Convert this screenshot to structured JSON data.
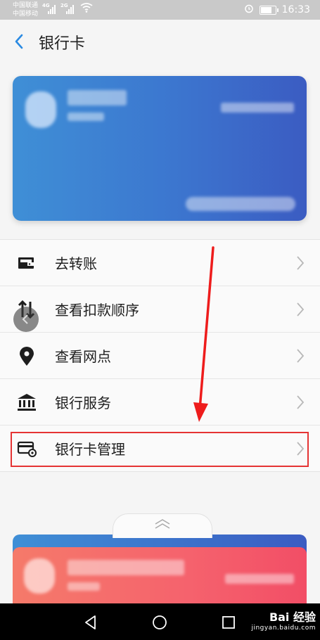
{
  "status_bar": {
    "carrier_1": "中国联通",
    "carrier_2": "中国移动",
    "network_1": "4G",
    "network_2": "2G",
    "time": "16:33",
    "icons": [
      "signal-icon",
      "wifi-icon",
      "alarm-icon",
      "battery-icon"
    ]
  },
  "header": {
    "title": "银行卡",
    "back_icon": "chevron-left-icon"
  },
  "menu": {
    "items": [
      {
        "label": "去转账",
        "icon": "wallet-icon"
      },
      {
        "label": "查看扣款顺序",
        "icon": "sort-arrows-icon"
      },
      {
        "label": "查看网点",
        "icon": "location-pin-icon"
      },
      {
        "label": "银行服务",
        "icon": "bank-icon"
      },
      {
        "label": "银行卡管理",
        "icon": "card-settings-icon"
      }
    ]
  },
  "colors": {
    "card_blue": "#3c76cf",
    "card_red": "#f5626d",
    "highlight_red": "#e53434",
    "accent_blue": "#2a8ae2"
  },
  "watermark": {
    "main": "Bai 经验",
    "sub": "jingyan.baidu.com"
  }
}
